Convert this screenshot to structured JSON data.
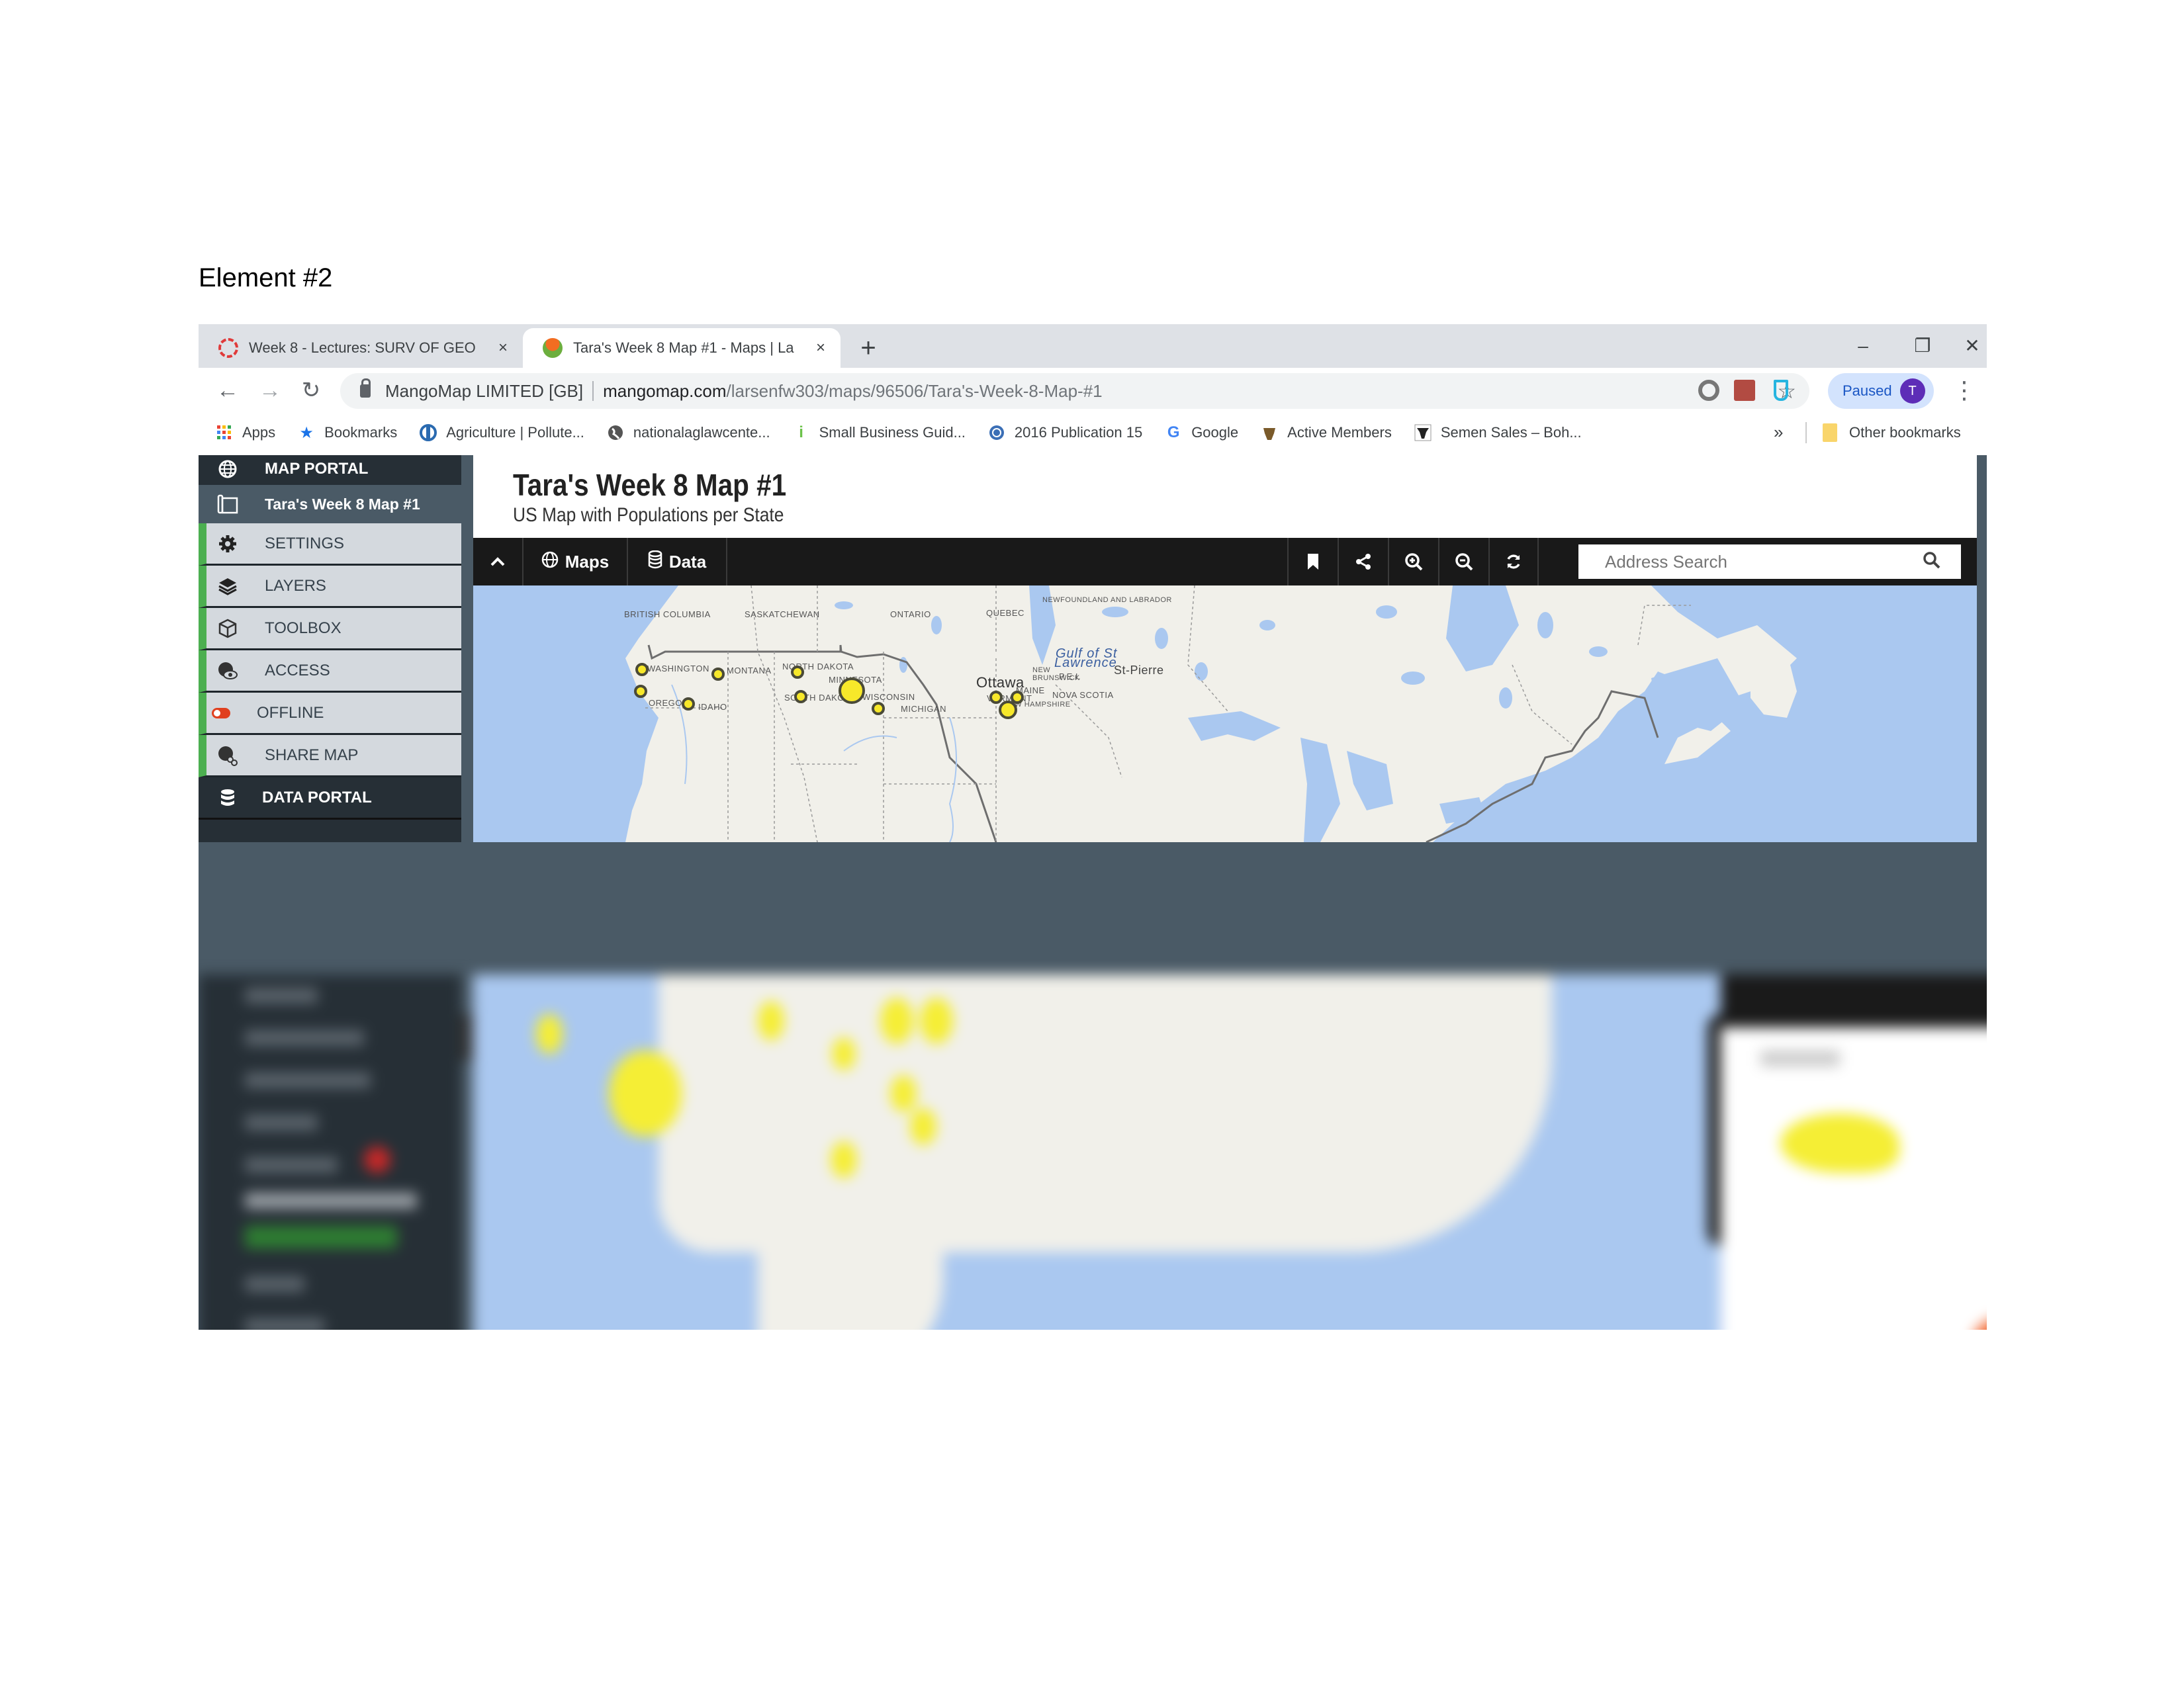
{
  "document": {
    "label": "Element #2"
  },
  "browser": {
    "tabs": [
      {
        "title": "Week 8 - Lectures: SURV OF GEO",
        "icon": "canvas-logo-icon",
        "active": false,
        "close": "×"
      },
      {
        "title": "Tara's Week 8 Map #1 - Maps | La",
        "icon": "mangomap-logo-icon",
        "active": true,
        "close": "×"
      }
    ],
    "new_tab": "+",
    "window_controls": {
      "minimize": "–",
      "restore": "❐",
      "close": "✕"
    },
    "nav": {
      "back": "←",
      "forward": "→",
      "reload": "↻"
    },
    "address": {
      "org": "MangoMap LIMITED [GB]",
      "host": "mangomap.com",
      "path": "/larsenfw303/maps/96506/Tara's-Week-8-Map-#1",
      "star": "☆"
    },
    "profile": {
      "status": "Paused",
      "initial": "T"
    },
    "menu": "⋮",
    "bookmarks": [
      {
        "label": "Apps",
        "icon": "apps-grid-icon"
      },
      {
        "label": "Bookmarks",
        "icon": "star-icon"
      },
      {
        "label": "Agriculture | Pollute...",
        "icon": "epa-icon"
      },
      {
        "label": "nationalaglawcente...",
        "icon": "globe-icon"
      },
      {
        "label": "Small Business Guid...",
        "icon": "sba-icon"
      },
      {
        "label": "2016 Publication 15",
        "icon": "irs-icon"
      },
      {
        "label": "Google",
        "icon": "google-icon"
      },
      {
        "label": "Active Members",
        "icon": "cattle-icon"
      },
      {
        "label": "Semen Sales – Boh...",
        "icon": "bull-icon"
      }
    ],
    "bookmarks_overflow": "»",
    "other_bookmarks": "Other bookmarks"
  },
  "sidebar": {
    "portal": "MAP PORTAL",
    "current_map": "Tara's Week 8 Map #1",
    "items": [
      {
        "label": "SETTINGS",
        "icon": "gear-icon"
      },
      {
        "label": "LAYERS",
        "icon": "layers-icon"
      },
      {
        "label": "TOOLBOX",
        "icon": "cube-icon"
      },
      {
        "label": "ACCESS",
        "icon": "globe-eye-icon"
      },
      {
        "label": "OFFLINE",
        "icon": "toggle-off-icon"
      },
      {
        "label": "SHARE MAP",
        "icon": "globe-link-icon"
      }
    ],
    "data_portal": "DATA PORTAL"
  },
  "map_app": {
    "title": "Tara's Week 8 Map #1",
    "subtitle": "US Map with Populations per State",
    "toolbar": {
      "collapse": "^",
      "maps": "Maps",
      "data": "Data",
      "search_placeholder": "Address Search"
    },
    "accent_colors": {
      "dot_fill": "#f7e82a",
      "sidebar_accent": "#4caf50",
      "offline_toggle": "#e0401f"
    },
    "labels": {
      "provinces": [
        "BRITISH COLUMBIA",
        "SASKATCHEWAN",
        "ONTARIO",
        "QUEBEC",
        "NEWFOUNDLAND AND LABRADOR",
        "NEW BRUNSWICK",
        "P.E.I.",
        "NOVA SCOTIA"
      ],
      "states": [
        "WASHINGTON",
        "MONTANA",
        "NORTH DAKOTA",
        "MINNESOTA",
        "SOUTH DAKOTA",
        "OREGON",
        "IDAHO",
        "WISCONSIN",
        "MICHIGAN",
        "MAINE",
        "VERMONT",
        "NEW HAMPSHIRE"
      ],
      "cities": [
        "Ottawa",
        "St-Pierre"
      ],
      "water": [
        "Gulf of St",
        "Lawrence"
      ]
    }
  }
}
